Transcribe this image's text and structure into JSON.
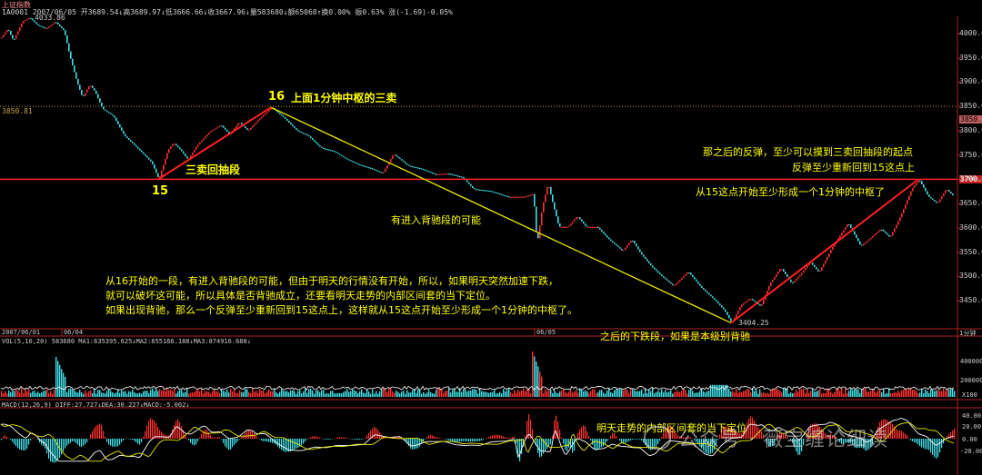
{
  "header": {
    "title": "上证指数",
    "info_line": "1A0001 2007/06/05 开3689.54↓高3689.97↓低3666.66↓收3667.96↓量583680↓额65068↑换0.00% 振0.63% 涨(-1.69)-0.05%"
  },
  "price_panel": {
    "max_label": "4033.86",
    "min_label": "3404.25",
    "ref_left": "3850.81",
    "ref_right": "3850.7",
    "ref_right_level": "3700.0",
    "y_ticks": [
      "4000.0",
      "3950.0",
      "3900.0",
      "3850.0",
      "3800.0",
      "3750.0",
      "3700.0",
      "3650.0",
      "3600.0",
      "3550.0",
      "3500.0",
      "3450.0"
    ]
  },
  "date_bar": {
    "d1": "2007/06/01",
    "d2": "06/04",
    "d3": "06/05",
    "unit": "1分钟"
  },
  "volume_panel": {
    "header": "VOL(5,10,20) 583680 MA1:635395.625↓MA2:655166.188↓MA3:874916.688↓",
    "y_ticks": [
      "400000",
      "200000",
      "X100"
    ]
  },
  "macd_panel": {
    "header": "MACD(12,26,9) DIFF:27.727↓DEA:30.227↓MACD:-5.002↓",
    "y_ticks": [
      "40.00",
      "20.00",
      "0.00",
      "-20.00"
    ]
  },
  "annotations": {
    "n16": "16",
    "label16": "上面1分钟中枢的三卖",
    "n15": "15",
    "pullback": "三卖回抽段",
    "divergence_possible": "有进入背驰段的可能",
    "rebound_1": "那之后的反弹，至少可以摸到三卖回抽段的起点",
    "rebound_2": "反弹至少重新回到15这点上",
    "from15": "从15这点开始至少形成一个1分钟的中枢了",
    "para1": "从16开始的一段，有进入背驰段的可能，但由于明天的行情没有开始，所以，如果明天突然加速下跌，",
    "para2": "就可以破坏这可能，所以具体是否背驰成立，还要看明天走势的内部区间套的当下定位。",
    "para3": "如果出现背驰，那么一个反弹至少重新回到15这点上，这样就从15这点开始至少形成一个1分钟的中枢了。",
    "later_down": "之后的下跌段，如果是本级别背驰",
    "tomorrow": "明天走势的内部区间套的当下定位"
  },
  "watermark": "公众号 · 薇宝缠论细读",
  "colors": {
    "up": "#ff3030",
    "down": "#40e0e8",
    "annot": "#ffff00",
    "line_red": "#ff2020",
    "line_yellow": "#e8e800",
    "white": "#ffffff"
  },
  "chart_data": {
    "type": "line",
    "title": "上证指数",
    "xlabel": "",
    "ylabel": "",
    "ylim": [
      3375,
      4050
    ],
    "price_path": [
      [
        0,
        3990
      ],
      [
        8,
        4010
      ],
      [
        14,
        3985
      ],
      [
        24,
        4025
      ],
      [
        32,
        4033
      ],
      [
        40,
        4018
      ],
      [
        50,
        4010
      ],
      [
        60,
        4025
      ],
      [
        70,
        4005
      ],
      [
        76,
        3955
      ],
      [
        84,
        3900
      ],
      [
        90,
        3868
      ],
      [
        98,
        3895
      ],
      [
        104,
        3880
      ],
      [
        112,
        3845
      ],
      [
        124,
        3830
      ],
      [
        136,
        3790
      ],
      [
        150,
        3765
      ],
      [
        166,
        3735
      ],
      [
        174,
        3700
      ],
      [
        184,
        3760
      ],
      [
        190,
        3775
      ],
      [
        198,
        3760
      ],
      [
        206,
        3740
      ],
      [
        216,
        3770
      ],
      [
        230,
        3798
      ],
      [
        242,
        3812
      ],
      [
        252,
        3792
      ],
      [
        262,
        3818
      ],
      [
        272,
        3800
      ],
      [
        282,
        3820
      ],
      [
        298,
        3848
      ],
      [
        312,
        3826
      ],
      [
        326,
        3800
      ],
      [
        338,
        3790
      ],
      [
        352,
        3765
      ],
      [
        366,
        3758
      ],
      [
        380,
        3742
      ],
      [
        394,
        3730
      ],
      [
        408,
        3722
      ],
      [
        420,
        3712
      ],
      [
        432,
        3752
      ],
      [
        448,
        3728
      ],
      [
        462,
        3722
      ],
      [
        478,
        3710
      ],
      [
        492,
        3712
      ],
      [
        508,
        3704
      ],
      [
        520,
        3680
      ],
      [
        538,
        3676
      ],
      [
        558,
        3664
      ],
      [
        576,
        3664
      ],
      [
        586,
        3670
      ],
      [
        590,
        3565
      ],
      [
        596,
        3645
      ],
      [
        602,
        3692
      ],
      [
        608,
        3645
      ],
      [
        614,
        3602
      ],
      [
        624,
        3602
      ],
      [
        634,
        3624
      ],
      [
        644,
        3602
      ],
      [
        656,
        3602
      ],
      [
        668,
        3578
      ],
      [
        684,
        3552
      ],
      [
        694,
        3576
      ],
      [
        704,
        3547
      ],
      [
        716,
        3520
      ],
      [
        726,
        3502
      ],
      [
        740,
        3480
      ],
      [
        756,
        3510
      ],
      [
        770,
        3478
      ],
      [
        786,
        3450
      ],
      [
        796,
        3430
      ],
      [
        804,
        3404
      ],
      [
        814,
        3440
      ],
      [
        824,
        3455
      ],
      [
        836,
        3438
      ],
      [
        846,
        3485
      ],
      [
        858,
        3518
      ],
      [
        870,
        3485
      ],
      [
        880,
        3505
      ],
      [
        890,
        3530
      ],
      [
        900,
        3508
      ],
      [
        914,
        3558
      ],
      [
        932,
        3610
      ],
      [
        946,
        3562
      ],
      [
        956,
        3578
      ],
      [
        968,
        3598
      ],
      [
        978,
        3580
      ],
      [
        990,
        3625
      ],
      [
        1002,
        3680
      ],
      [
        1010,
        3700
      ],
      [
        1020,
        3665
      ],
      [
        1030,
        3650
      ],
      [
        1040,
        3680
      ],
      [
        1048,
        3665
      ]
    ],
    "points": {
      "p16": [
        298,
        3848
      ],
      "p15": [
        174,
        3700
      ],
      "low": [
        804,
        3404
      ],
      "high": [
        32,
        4033
      ]
    },
    "levels": {
      "ref_3850": 3850,
      "line_15": 3700
    }
  }
}
